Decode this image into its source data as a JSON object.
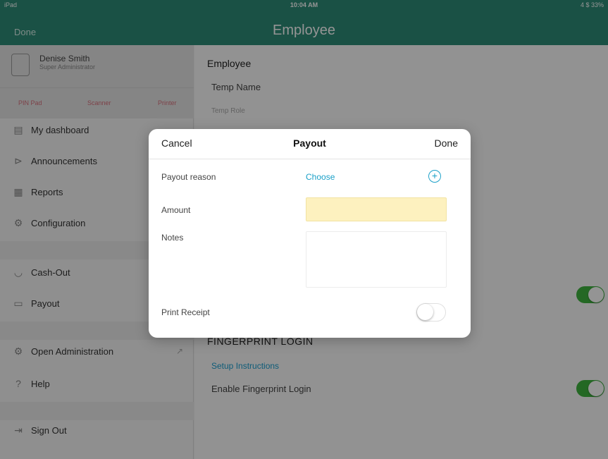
{
  "status_bar": {
    "carrier": "iPad",
    "time": "10:04 AM",
    "battery": "4 $ 33%"
  },
  "nav": {
    "done_label": "Done",
    "title": "Employee"
  },
  "sidebar": {
    "user": {
      "name": "Denise Smith",
      "role": "Super Administrator"
    },
    "devices": [
      "PIN Pad",
      "Scanner",
      "Printer"
    ],
    "items": [
      {
        "label": "My dashboard",
        "icon": "dashboard-icon"
      },
      {
        "label": "Announcements",
        "icon": "announcements-icon"
      },
      {
        "label": "Reports",
        "icon": "reports-icon"
      },
      {
        "label": "Configuration",
        "icon": "configuration-icon"
      },
      {
        "label": "Cash-Out",
        "icon": "cash-out-icon"
      },
      {
        "label": "Payout",
        "icon": "payout-icon"
      },
      {
        "label": "Open Administration",
        "icon": "administration-icon"
      },
      {
        "label": "Help",
        "icon": "help-icon"
      },
      {
        "label": "Sign Out",
        "icon": "sign-out-icon"
      }
    ]
  },
  "main": {
    "section_title": "Employee",
    "name_value": "Temp Name",
    "role_value": "Temp Role",
    "fingerprint_header": "FINGERPRINT LOGIN",
    "setup_link": "Setup Instructions",
    "enable_fingerprint_label": "Enable Fingerprint Login"
  },
  "modal": {
    "cancel_label": "Cancel",
    "title": "Payout",
    "done_label": "Done",
    "payout_reason_label": "Payout reason",
    "choose_label": "Choose",
    "amount_label": "Amount",
    "amount_value": "",
    "notes_label": "Notes",
    "notes_value": "",
    "print_receipt_label": "Print Receipt",
    "print_receipt_on": false
  },
  "colors": {
    "brand": "#2d8c78",
    "link": "#1aa0c8",
    "toggle_on": "#3fb33f",
    "amount_bg": "#fdf1bf"
  }
}
